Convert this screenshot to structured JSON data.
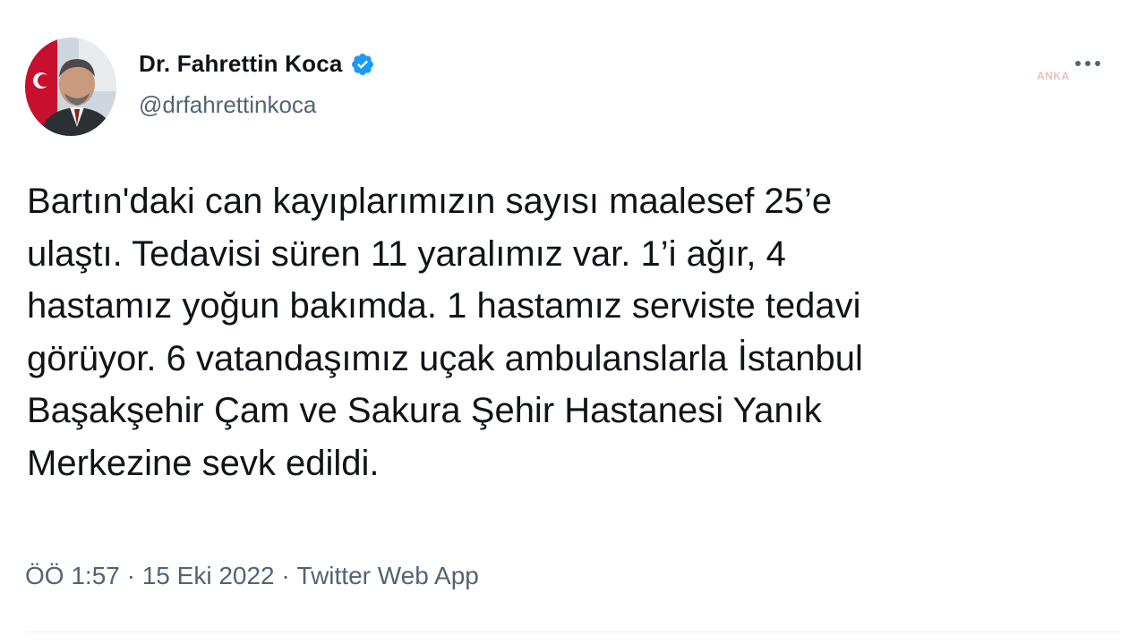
{
  "author": {
    "display_name": "Dr. Fahrettin Koca",
    "handle": "@drfahrettinkoca",
    "verified": true
  },
  "tweet": {
    "text": "Bartın'daki can kayıplarımızın sayısı maalesef 25’e\nulaştı. Tedavisi süren 11 yaralımız var. 1’i ağır, 4\nhastamız yoğun bakımda. 1 hastamız serviste tedavi\ngörüyor. 6 vatandaşımız uçak ambulanslarla İstanbul\nBaşakşehir Çam ve Sakura Şehir Hastanesi Yanık\nMerkezine sevk edildi."
  },
  "meta": {
    "time": "ÖÖ 1:57",
    "separator": " · ",
    "date": "15 Eki 2022",
    "source": "Twitter Web App"
  },
  "watermark": "ANKA",
  "colors": {
    "verified_blue": "#1d9bf0",
    "text_primary": "#0f1419",
    "text_secondary": "#536471"
  },
  "icons": {
    "verified": "verified-badge-icon",
    "more": "more-dots-icon"
  }
}
